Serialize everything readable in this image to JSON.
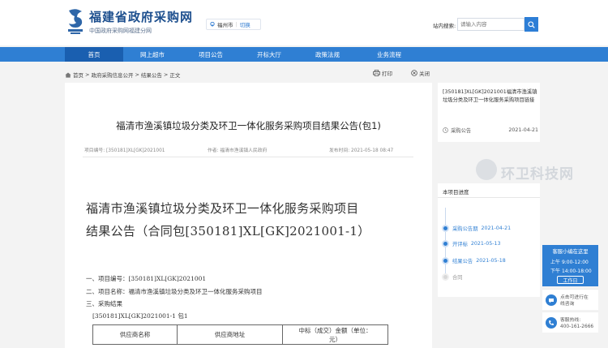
{
  "header": {
    "site_title": "福建省政府采购网",
    "site_subtitle": "中国政府采购网福建分网",
    "city": "福州市",
    "city_switch": "切换",
    "search_label": "站内搜索:",
    "search_placeholder": "请输入内容"
  },
  "nav": {
    "items": [
      {
        "label": "首页",
        "active": true
      },
      {
        "label": "网上超市"
      },
      {
        "label": "项目公告"
      },
      {
        "label": "开标大厅"
      },
      {
        "label": "政策法规"
      },
      {
        "label": "业务流程"
      }
    ]
  },
  "breadcrumb": {
    "home": "首页",
    "sep": ">",
    "level1": "政府采购信息公开",
    "level2": "结果公告",
    "level3": "正文"
  },
  "toolbar": {
    "print": "打印",
    "close": "关闭"
  },
  "article": {
    "title": "福清市渔溪镇垃圾分类及环卫一体化服务采购项目结果公告(包1)",
    "meta_code_label": "项目编号:",
    "meta_code": "[350181]XL[GK]2021001",
    "meta_author_label": "作者:",
    "meta_author": "福清市渔溪镇人民政府",
    "meta_date_label": "发布时间:",
    "meta_date": "2021-05-18 08:47",
    "big_title_line1": "福清市渔溪镇垃圾分类及环卫一体化服务采购项目",
    "big_title_line2": "结果公告（合同包[350181]XL[GK]2021001-1）",
    "item1_label": "一、项目编号：",
    "item1_value": "[350181]XL[GK]2021001",
    "item2_label": "二、项目名称：",
    "item2_value": "福清市渔溪镇垃圾分类及环卫一体化服务采购项目",
    "item3_label": "三、采购结果",
    "package_line": "[350181]XL[GK]2021001-1 包1",
    "table_headers": [
      "供应商名称",
      "供应商地址",
      "中标（成交）金额（单位：",
      "元）"
    ]
  },
  "sidebar": {
    "related_link": "[350181]XL[GK]2021001福清市渔溪镇垃圾分类及环卫一体化服务采购项目链接",
    "related_type": "采购公告",
    "related_date": "2021-04-21",
    "progress_title": "本项目进度",
    "progress": [
      {
        "label": "采购公告期",
        "date": "2021-04-21",
        "active": true
      },
      {
        "label": "开评标",
        "date": "2021-05-13",
        "active": true
      },
      {
        "label": "结果公告",
        "date": "2021-05-18",
        "active": true
      },
      {
        "label": "合同",
        "date": "",
        "active": false
      }
    ]
  },
  "watermark": "环卫科技网",
  "service": {
    "title": "客服小编在这里",
    "am_label": "上午",
    "am_time": "9:00-12:00",
    "pm_label": "下午",
    "pm_time": "14:00-18:00",
    "button": "工作日",
    "chat_line1": "点击可进行在",
    "chat_line2": "线咨询",
    "hotline_label": "客服热线:",
    "hotline": "400-161-2666"
  },
  "colors": {
    "brand_blue": "#2f7fd3",
    "nav_active": "#1a5fb0",
    "title_blue": "#1d4f8e"
  }
}
